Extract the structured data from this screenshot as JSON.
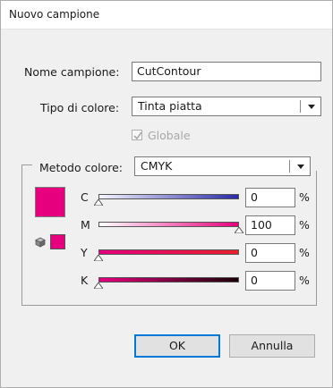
{
  "window": {
    "title": "Nuovo campione"
  },
  "fields": {
    "nome_label": "Nome campione:",
    "nome_value": "CutContour",
    "tipo_label": "Tipo di colore:",
    "tipo_value": "Tinta piatta",
    "globale_label": "Globale",
    "globale_checked": true,
    "metodo_label": "Metodo colore:",
    "metodo_value": "CMYK"
  },
  "swatch_color": "#e6007e",
  "channels": [
    {
      "label": "C",
      "value": "0",
      "unit": "%",
      "gradient": [
        "#f5f5ff",
        "#2a2aa8"
      ]
    },
    {
      "label": "M",
      "value": "100",
      "unit": "%",
      "gradient": [
        "#ffffff",
        "#e6007e"
      ]
    },
    {
      "label": "Y",
      "value": "0",
      "unit": "%",
      "gradient": [
        "#e6007e",
        "#e8202a"
      ]
    },
    {
      "label": "K",
      "value": "0",
      "unit": "%",
      "gradient": [
        "#e6007e",
        "#1a0006"
      ]
    }
  ],
  "buttons": {
    "ok": "OK",
    "cancel": "Annulla"
  }
}
